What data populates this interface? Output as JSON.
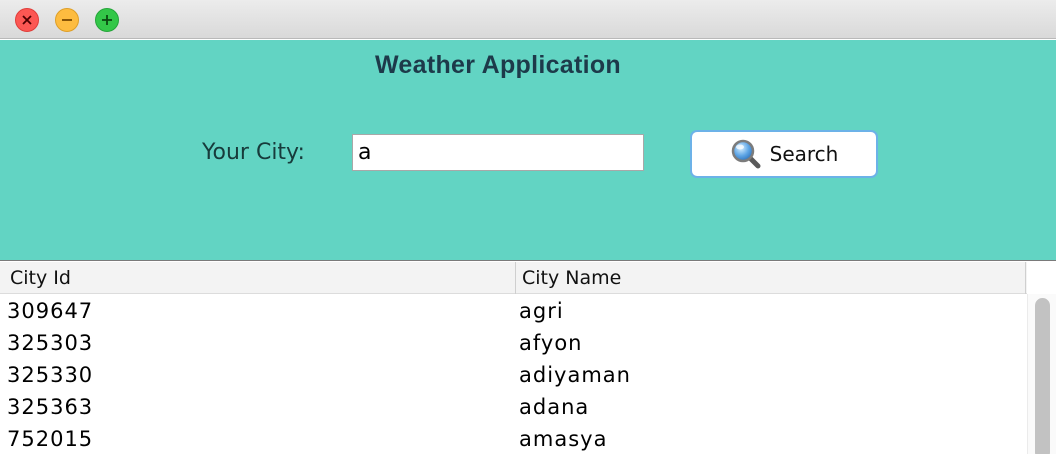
{
  "window": {
    "buttons": [
      "close",
      "minimize",
      "maximize"
    ]
  },
  "header": {
    "title": "Weather Application"
  },
  "search": {
    "label": "Your City:",
    "value": "a",
    "button_label": "Search",
    "button_icon": "magnifier-icon"
  },
  "table": {
    "columns": [
      "City Id",
      "City Name"
    ],
    "rows": [
      [
        "309647",
        "agri"
      ],
      [
        "325303",
        "afyon"
      ],
      [
        "325330",
        "adiyaman"
      ],
      [
        "325363",
        "adana"
      ],
      [
        "752015",
        "amasya"
      ]
    ]
  },
  "colors": {
    "panel_background": "#62d4c3",
    "title_text": "#1d3a4a",
    "button_border": "#6cb2e8"
  }
}
